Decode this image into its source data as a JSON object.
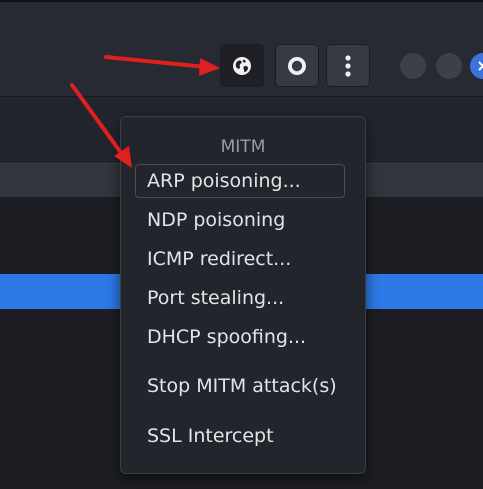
{
  "toolbar": {
    "buttons": [
      {
        "id": "mitm",
        "icon": "globe-icon"
      },
      {
        "id": "record",
        "icon": "record-icon"
      },
      {
        "id": "more",
        "icon": "vertical-dots-icon"
      }
    ]
  },
  "window_controls": [
    "minimize",
    "maximize",
    "close"
  ],
  "menu": {
    "title": "MITM",
    "items": [
      {
        "label": "ARP poisoning..."
      },
      {
        "label": "NDP poisoning"
      },
      {
        "label": "ICMP redirect..."
      },
      {
        "label": "Port stealing..."
      },
      {
        "label": "DHCP spoofing..."
      },
      {
        "label": "Stop MITM attack(s)"
      },
      {
        "label": "SSL Intercept"
      }
    ]
  },
  "colors": {
    "annotation_arrow": "#e0201f",
    "selection": "#2d7ae6",
    "close_button": "#3b73d9"
  }
}
